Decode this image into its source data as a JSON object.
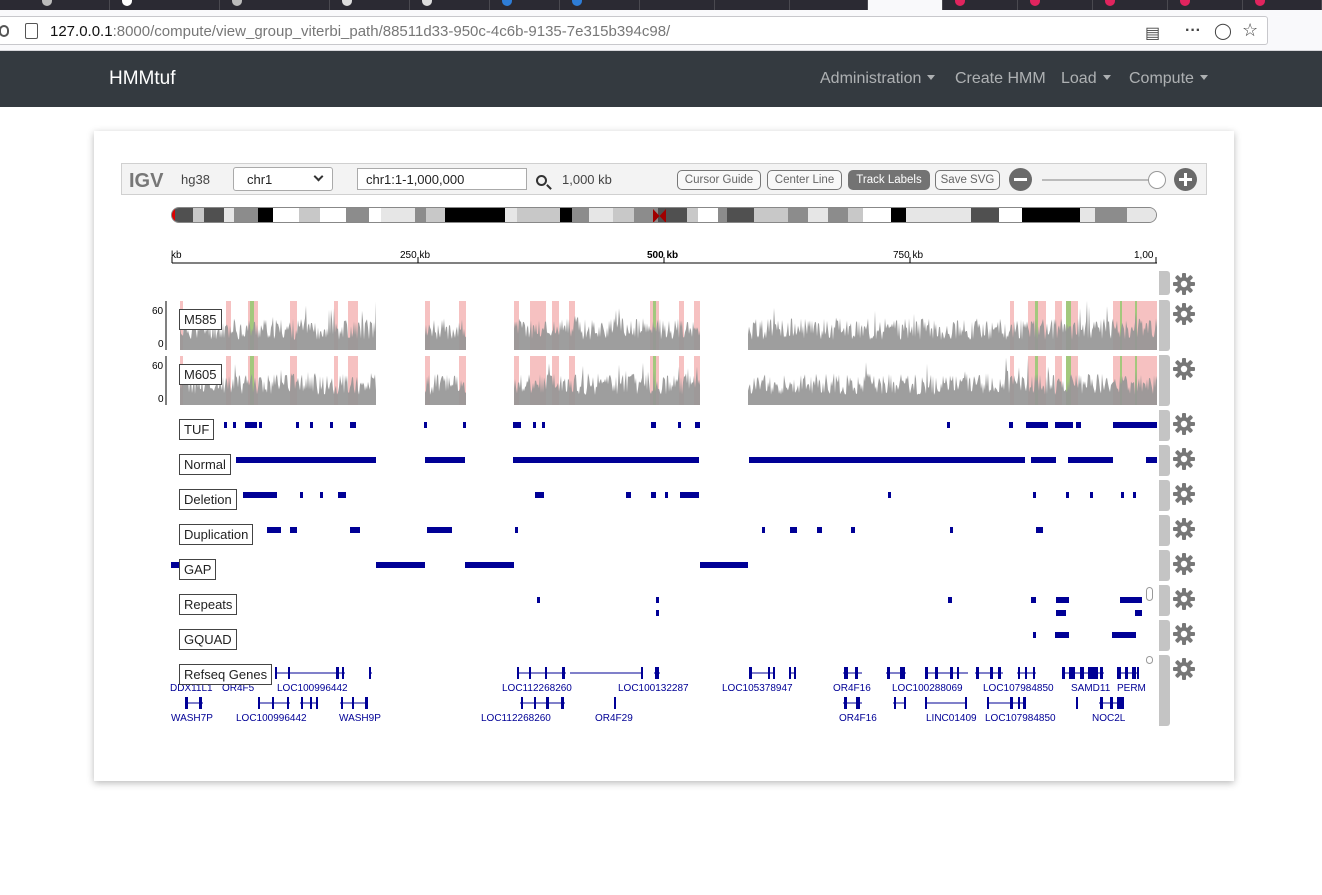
{
  "browser": {
    "url_host": "127.0.0.1",
    "url_rest": ":8000/compute/view_group_viterbi_path/88511d33-950c-4c6b-9135-7e315b394c98/"
  },
  "navbar": {
    "brand": "HMMtuf",
    "items": [
      {
        "label": "Administration",
        "dropdown": true
      },
      {
        "label": "Create HMM",
        "dropdown": false
      },
      {
        "label": "Load",
        "dropdown": true
      },
      {
        "label": "Compute",
        "dropdown": true
      }
    ]
  },
  "igv": {
    "logo": "IGV",
    "genome": "hg38",
    "chromosome": "chr1",
    "locus": "chr1:1-1,000,000",
    "window_width": "1,000 kb",
    "buttons": [
      {
        "label": "Cursor Guide",
        "active": false
      },
      {
        "label": "Center Line",
        "active": false
      },
      {
        "label": "Track Labels",
        "active": true
      },
      {
        "label": "Save SVG",
        "active": false
      }
    ],
    "zoom_level": 1.0,
    "ruler": {
      "ticks": [
        "kb",
        "250 kb",
        "500 kb",
        "750 kb",
        "1,00"
      ]
    }
  },
  "tracks": [
    {
      "name": "M585",
      "type": "coverage",
      "scale_max": "60",
      "scale_min": "0"
    },
    {
      "name": "M605",
      "type": "coverage",
      "scale_max": "60",
      "scale_min": "0"
    },
    {
      "name": "TUF",
      "type": "feature"
    },
    {
      "name": "Normal",
      "type": "feature"
    },
    {
      "name": "Deletion",
      "type": "feature"
    },
    {
      "name": "Duplication",
      "type": "feature"
    },
    {
      "name": "GAP",
      "type": "feature"
    },
    {
      "name": "Repeats",
      "type": "feature"
    },
    {
      "name": "GQUAD",
      "type": "feature"
    },
    {
      "name": "Refseq Genes",
      "type": "annotation"
    }
  ],
  "genes_row1": [
    "DDX11L1",
    "OR4F5",
    "LOC100996442",
    "LOC112268260",
    "LOC100132287",
    "LOC105378947",
    "OR4F16",
    "LOC100288069",
    "LOC107984850",
    "SAMD11",
    "PERM"
  ],
  "genes_row2": [
    "WASH7P",
    "LOC100996442",
    "WASH9P",
    "LOC112268260",
    "OR4F29",
    "OR4F16",
    "LINC01409",
    "LOC107984850",
    "NOC2L"
  ],
  "colors": {
    "navbar": "#343a40",
    "feature": "#000096",
    "coverage": "#969696",
    "highlight_red": "#f4b6b6",
    "highlight_green": "#8fc96c"
  }
}
